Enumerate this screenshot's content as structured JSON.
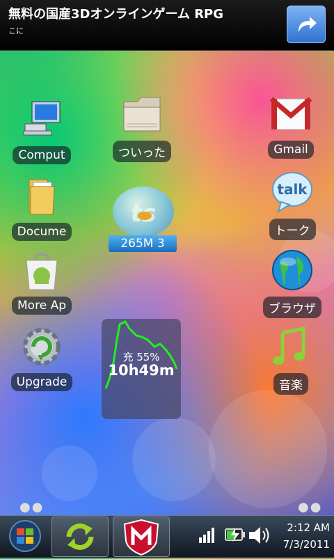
{
  "ad": {
    "title": "無料の国産3Dオンラインゲーム RPG",
    "subtitle": "こに",
    "share_icon": "share-arrow-icon"
  },
  "apps": {
    "computer": "Comput",
    "folder": "ついった",
    "gmail": "Gmail",
    "documents": "Docume",
    "talk": "トーク",
    "more_apps": "More Ap",
    "browser": "ブラウザ",
    "upgrade": "Upgrade",
    "music": "音楽"
  },
  "memory_widget": {
    "text": "265M  3"
  },
  "battery_widget": {
    "percent": "充 55%",
    "time": "10h49m",
    "line_color": "#1aff1a"
  },
  "taskbar": {
    "time": "2:12 AM",
    "date": "7/3/2011"
  },
  "colors": {
    "ad_button": "#2f72d2",
    "battery_line": "#22ee22"
  }
}
